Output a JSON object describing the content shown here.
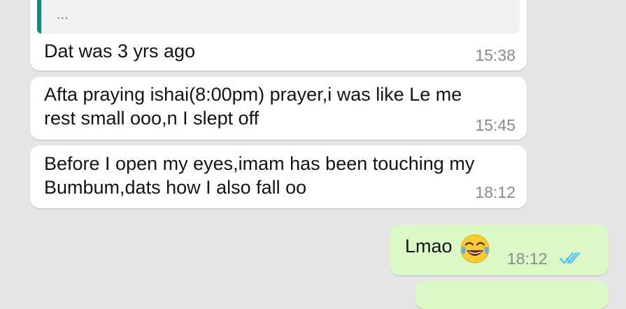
{
  "chat": {
    "quoted": {
      "preview": "..."
    },
    "messages": [
      {
        "direction": "incoming",
        "text": "Dat was 3 yrs ago",
        "time": "15:38"
      },
      {
        "direction": "incoming",
        "text": "Afta praying ishai(8:00pm) prayer,i was like Le me\nrest small ooo,n I slept off",
        "time": "15:45"
      },
      {
        "direction": "incoming",
        "text": "Before I open my eyes,imam has been touching my\nBumbum,dats how I also fall oo",
        "time": "18:12"
      },
      {
        "direction": "outgoing",
        "text": "Lmao",
        "emoji": "face-with-tears-of-joy-icon",
        "time": "18:12",
        "status": "read-double-check-icon"
      }
    ]
  },
  "colors": {
    "background": "#e5e5e5",
    "incoming_bubble": "#ffffff",
    "outgoing_bubble": "#dcf8c6",
    "quote_accent": "#0f8a7a",
    "read_ticks": "#4fc3f7",
    "timestamp": "#8a8a8a"
  }
}
